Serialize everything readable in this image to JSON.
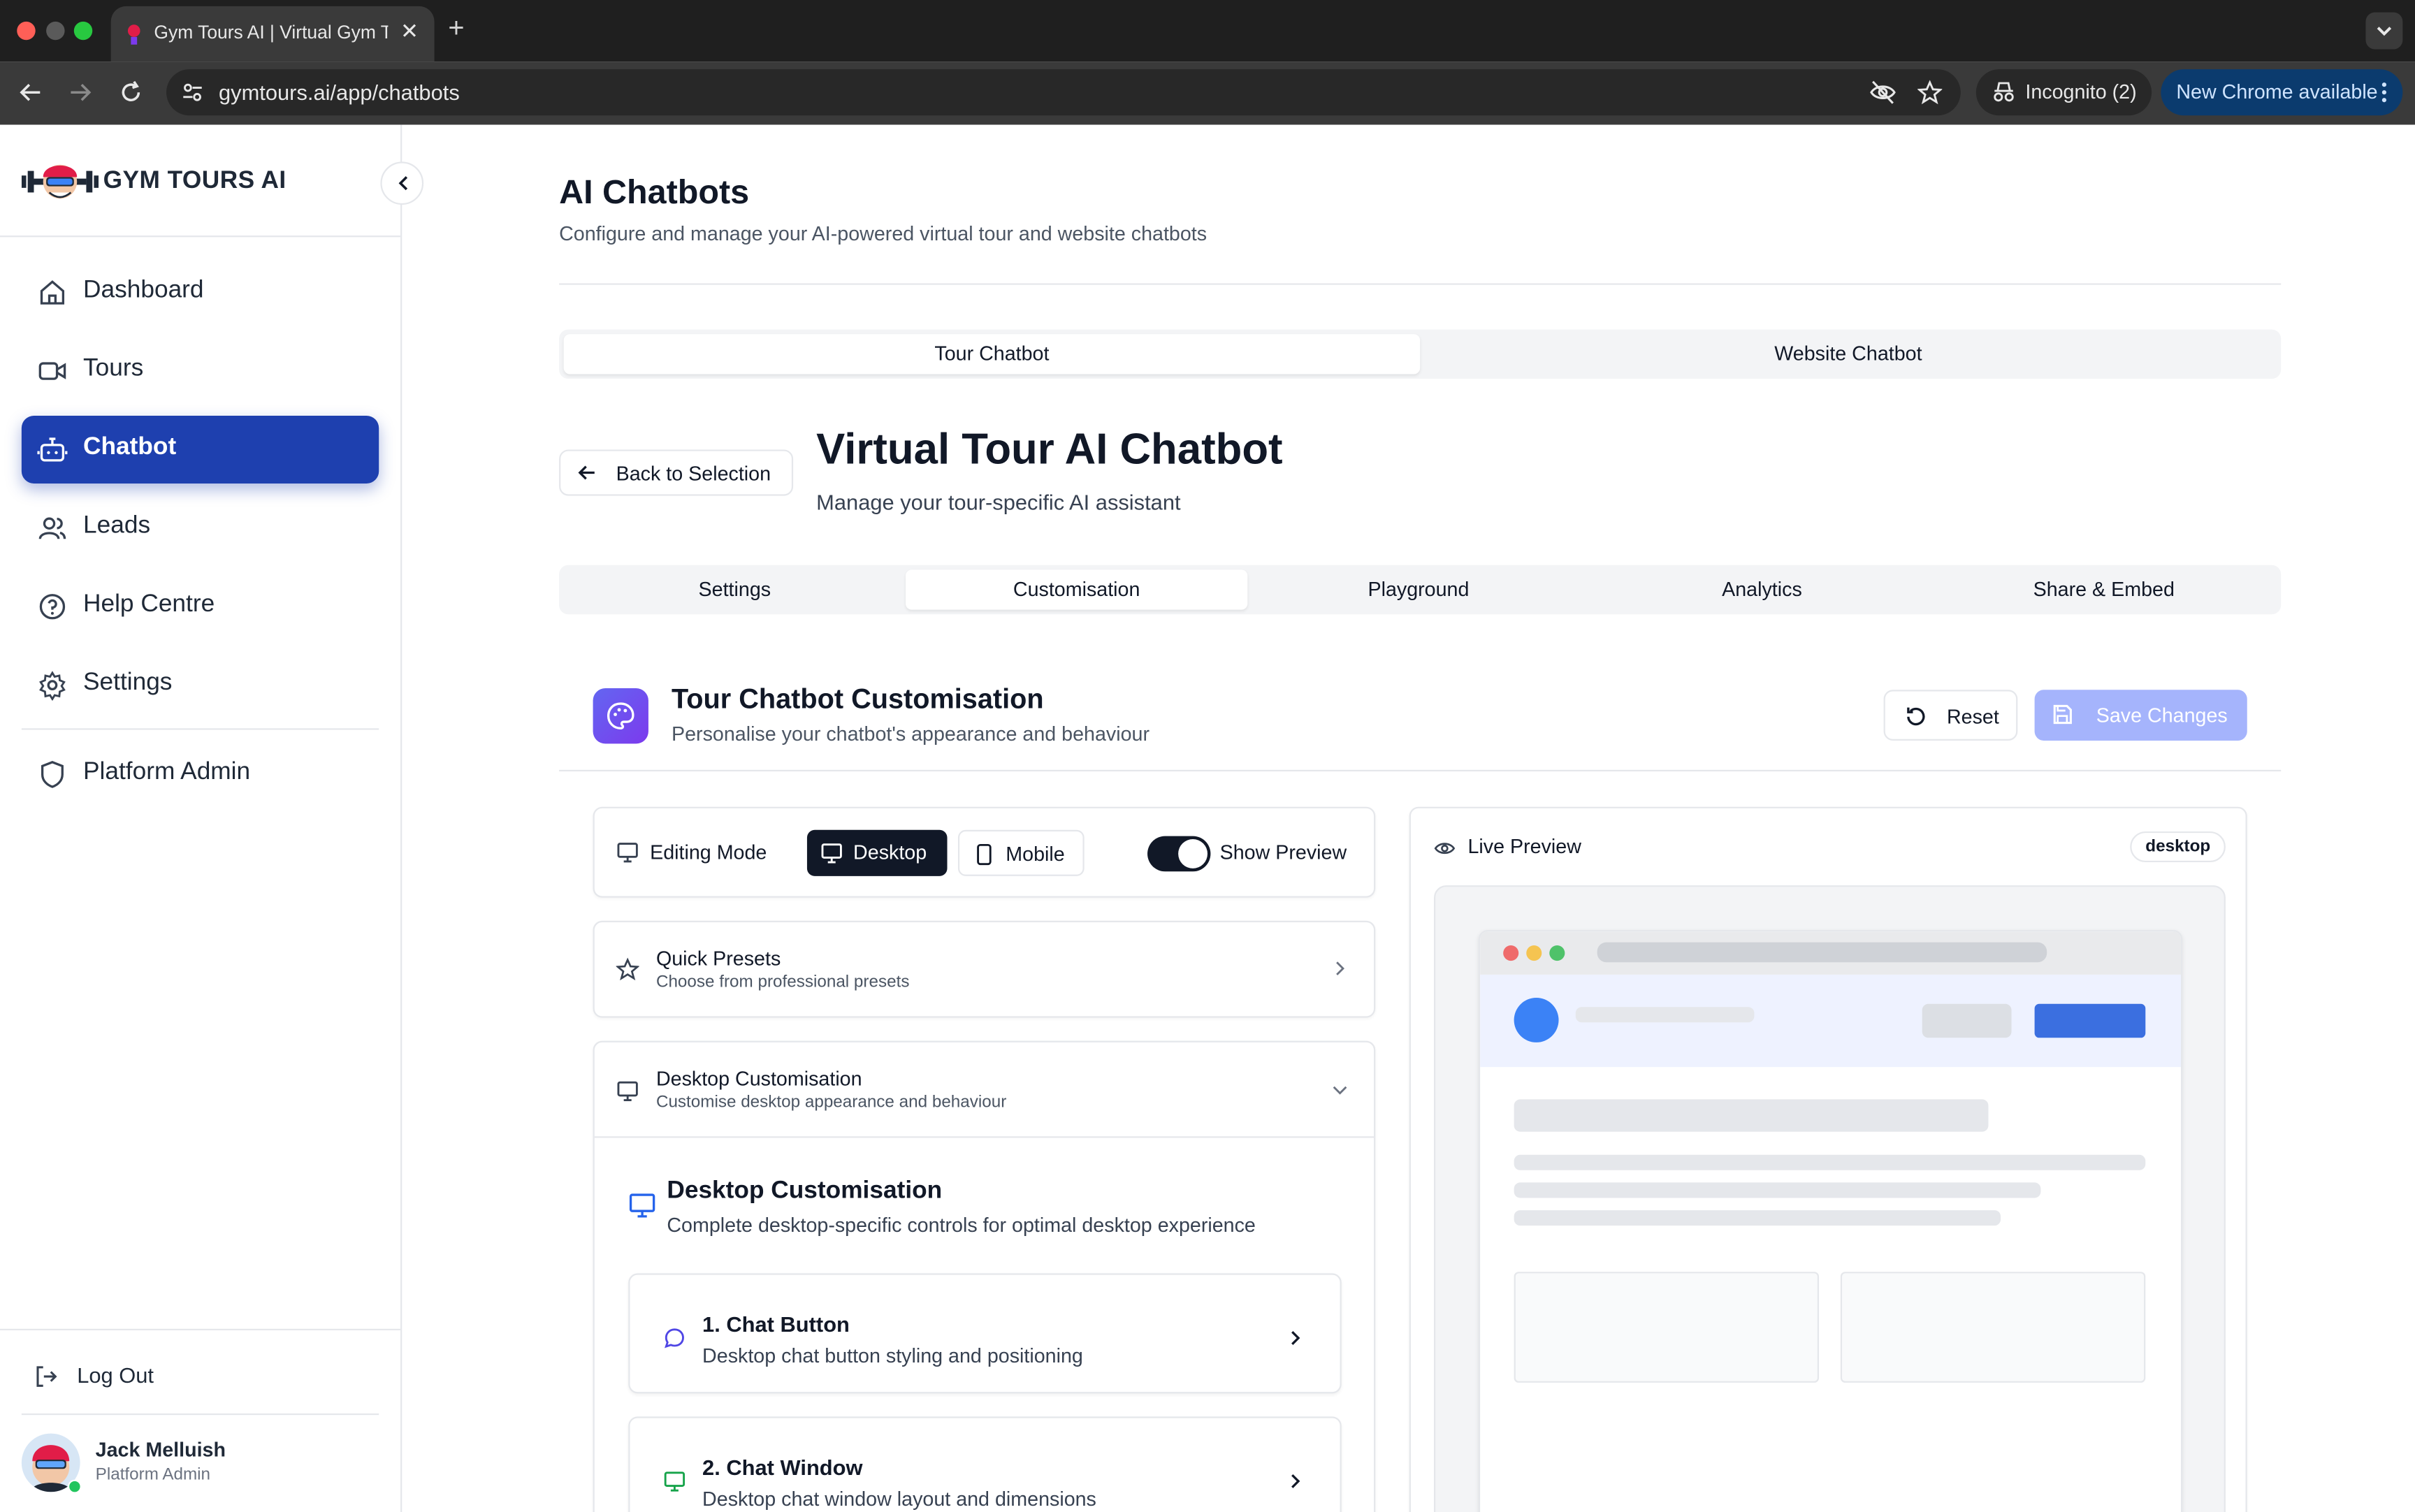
{
  "browser": {
    "tab_title": "Gym Tours AI | Virtual Gym Tours",
    "url": "gymtours.ai/app/chatbots",
    "incognito_label": "Incognito (2)",
    "update_label": "New Chrome available"
  },
  "sidebar": {
    "logo_text": "GYM TOURS AI",
    "items": [
      {
        "label": "Dashboard",
        "icon": "home-icon"
      },
      {
        "label": "Tours",
        "icon": "video-icon"
      },
      {
        "label": "Chatbot",
        "icon": "bot-icon",
        "active": true
      },
      {
        "label": "Leads",
        "icon": "users-icon"
      },
      {
        "label": "Help Centre",
        "icon": "help-circle-icon"
      },
      {
        "label": "Settings",
        "icon": "gear-icon"
      }
    ],
    "admin_item": {
      "label": "Platform Admin",
      "icon": "shield-icon"
    },
    "logout_label": "Log Out",
    "user": {
      "name": "Jack Melluish",
      "role": "Platform Admin"
    }
  },
  "header": {
    "title": "AI Chatbots",
    "subtitle": "Configure and manage your AI-powered virtual tour and website chatbots"
  },
  "chatbot_switch": {
    "options": [
      "Tour Chatbot",
      "Website Chatbot"
    ],
    "selected": "Tour Chatbot"
  },
  "chatbot_page": {
    "back_label": "Back to Selection",
    "title": "Virtual Tour AI Chatbot",
    "subtitle": "Manage your tour-specific AI assistant"
  },
  "tabs": {
    "items": [
      "Settings",
      "Customisation",
      "Playground",
      "Analytics",
      "Share & Embed"
    ],
    "selected": "Customisation"
  },
  "customisation": {
    "title": "Tour Chatbot Customisation",
    "subtitle": "Personalise your chatbot's appearance and behaviour",
    "reset_label": "Reset",
    "save_label": "Save Changes",
    "accent_color": "#6366f1"
  },
  "editing": {
    "label": "Editing Mode",
    "modes": [
      "Desktop",
      "Mobile"
    ],
    "selected": "Desktop",
    "preview_label": "Show Preview",
    "preview_on": true
  },
  "presets": {
    "title": "Quick Presets",
    "subtitle": "Choose from professional presets"
  },
  "desktop_section": {
    "title": "Desktop Customisation",
    "subtitle": "Customise desktop appearance and behaviour",
    "inner_title": "Desktop Customisation",
    "inner_subtitle": "Complete desktop-specific controls for optimal desktop experience",
    "items": [
      {
        "title": "1. Chat Button",
        "subtitle": "Desktop chat button styling and positioning",
        "icon": "message-circle-icon"
      },
      {
        "title": "2. Chat Window",
        "subtitle": "Desktop chat window layout and dimensions",
        "icon": "monitor-icon"
      }
    ]
  },
  "preview": {
    "label": "Live Preview",
    "badge": "desktop"
  }
}
